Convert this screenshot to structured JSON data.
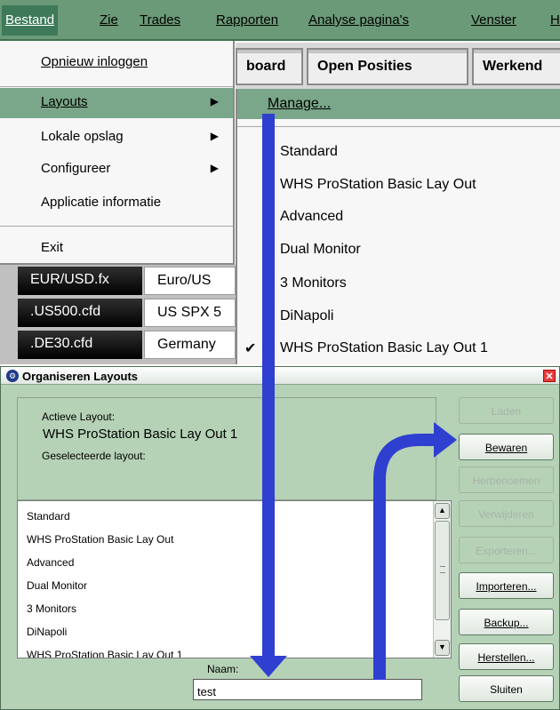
{
  "menubar": {
    "items": [
      "Bestand",
      "Zie",
      "Trades",
      "Rapporten",
      "Analyse pagina's",
      "Venster",
      "H"
    ]
  },
  "tabs": [
    "board",
    "Open Posities",
    "Werkend"
  ],
  "file_menu": {
    "items": [
      {
        "label": "Opnieuw inloggen",
        "submenu": false
      },
      {
        "label": "Layouts",
        "submenu": true
      },
      {
        "label": "Lokale opslag",
        "submenu": true
      },
      {
        "label": "Configureer",
        "submenu": true
      },
      {
        "label": "Applicatie informatie",
        "submenu": false
      },
      {
        "label": "Exit",
        "submenu": false
      }
    ],
    "highlighted": "Layouts",
    "arrow": "▶"
  },
  "layouts_submenu": {
    "manage": "Manage...",
    "items": [
      "Standard",
      "WHS ProStation Basic Lay Out",
      "Advanced",
      "Dual Monitor",
      "3 Monitors",
      "DiNapoli",
      "WHS ProStation Basic Lay Out 1"
    ],
    "checked": "WHS ProStation Basic Lay Out 1",
    "check_glyph": "✔"
  },
  "instruments": [
    {
      "symbol": "EUR/USD.fx",
      "name": "Euro/US"
    },
    {
      "symbol": ".US500.cfd",
      "name": "US SPX 5"
    },
    {
      "symbol": ".DE30.cfd",
      "name": "Germany"
    }
  ],
  "dialog": {
    "title": "Organiseren Layouts",
    "close": "✕",
    "icon_glyph": "⚙",
    "actieve_label": "Actieve Layout:",
    "actieve_value": "WHS ProStation Basic Lay Out 1",
    "geselecteerde_label": "Geselecteerde layout:",
    "list": [
      "Standard",
      "WHS ProStation Basic Lay Out",
      "Advanced",
      "Dual Monitor",
      "3 Monitors",
      "DiNapoli",
      "WHS ProStation Basic Lay Out 1"
    ],
    "naam_label": "Naam:",
    "naam_value": "test",
    "scroll_up": "▲",
    "scroll_down": "▼",
    "buttons": [
      {
        "label": "Laden",
        "enabled": false
      },
      {
        "label": "Bewaren",
        "enabled": true
      },
      {
        "label": "Herbenoemen",
        "enabled": false
      },
      {
        "label": "Verwijderen",
        "enabled": false
      },
      {
        "label": "Exporteren...",
        "enabled": false
      },
      {
        "label": "Importeren...",
        "enabled": true
      },
      {
        "label": "Backup...",
        "enabled": true
      },
      {
        "label": "Herstellen...",
        "enabled": true
      },
      {
        "label": "Sluiten",
        "enabled": true
      }
    ]
  },
  "colors": {
    "menubar": "#6b9a78",
    "highlight": "#7aa789",
    "dialog_bg": "#b5d1b6",
    "arrow": "#2f3fd0"
  }
}
